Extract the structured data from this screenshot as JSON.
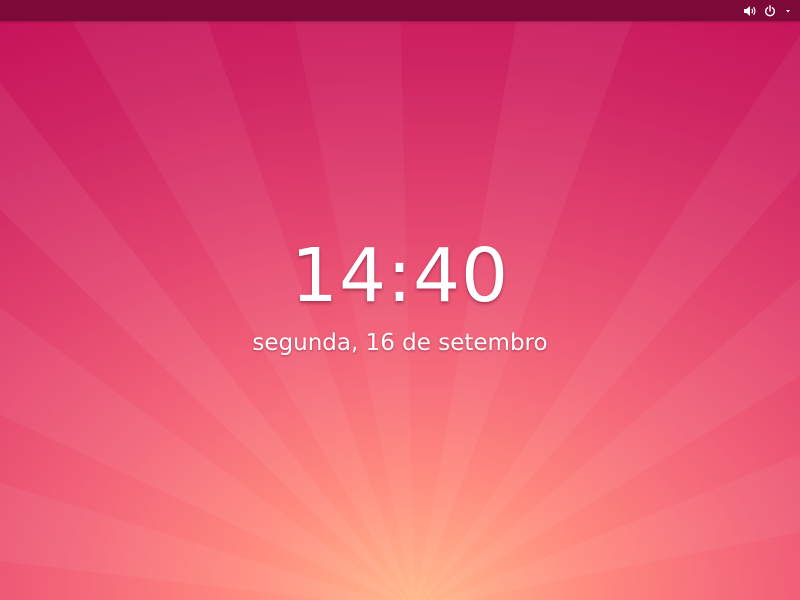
{
  "lock_screen": {
    "time": "14:40",
    "date": "segunda, 16 de setembro"
  },
  "top_bar": {
    "indicators": [
      {
        "name": "volume",
        "icon": "speaker-volume-icon"
      },
      {
        "name": "power",
        "icon": "power-icon",
        "menu_icon": "chevron-down-icon"
      }
    ]
  },
  "colors": {
    "top_bar": "#7c0a38",
    "background_top": "#c20f57",
    "background_bottom": "#ffb98c",
    "text": "#ffffff"
  }
}
